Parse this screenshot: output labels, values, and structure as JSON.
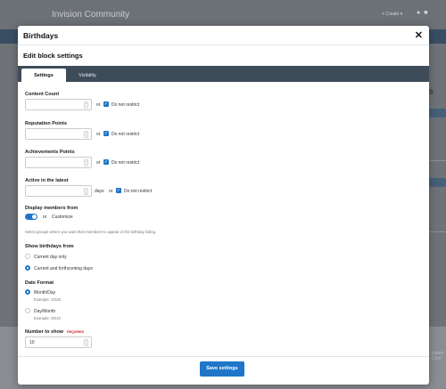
{
  "background": {
    "site_title": "Invision Community",
    "create_label": "+ Create ▾",
    "footer_text": "ssport Com"
  },
  "modal": {
    "title": "Birthdays",
    "close_glyph": "✕",
    "subtitle": "Edit block settings",
    "tabs": [
      "Settings",
      "Visibility"
    ]
  },
  "form": {
    "content_count": {
      "label": "Content Count",
      "value": "",
      "or": "or",
      "checkbox_label": "Do not restrict",
      "checked": true
    },
    "reputation_points": {
      "label": "Reputation Points",
      "value": "",
      "or": "or",
      "checkbox_label": "Do not restrict",
      "checked": true
    },
    "achievements_points": {
      "label": "Achievements Points",
      "value": "",
      "or": "or",
      "checkbox_label": "Do not restrict",
      "checked": true
    },
    "active_latest": {
      "label": "Active in the latest",
      "value": "",
      "unit": "days",
      "or": "or",
      "checkbox_label": "Do not restrict",
      "checked": true
    },
    "display_members": {
      "label": "Display members from",
      "or": "or",
      "customize": "Customize",
      "description": "Select groups where you want their members to appear in the birthday listing."
    },
    "show_birthdays": {
      "label": "Show birthdays from",
      "options": [
        "Current day only",
        "Current and forthcoming days"
      ],
      "selected": 1
    },
    "date_format": {
      "label": "Date Format",
      "options": [
        {
          "label": "Month/Day",
          "example": "Example: 10/25"
        },
        {
          "label": "Day/Month",
          "example": "Example: 25/10"
        }
      ],
      "selected": 0
    },
    "number_to_show": {
      "label": "Number to show",
      "required": "REQUIRED",
      "value": "10"
    }
  },
  "footer": {
    "save_label": "Save settings"
  },
  "colors": {
    "accent": "#1f76c8",
    "tabbar": "#3e4b59",
    "required": "#d0202a"
  }
}
